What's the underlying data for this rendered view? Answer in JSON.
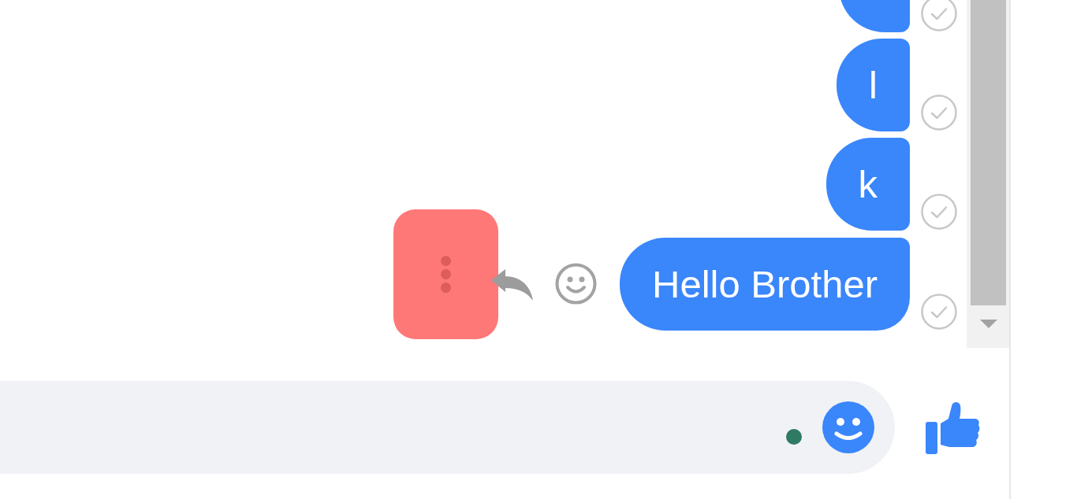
{
  "messages": [
    {
      "sent": true
    },
    {
      "text": "l",
      "sent": true
    },
    {
      "text": "k",
      "sent": true
    },
    {
      "text": "Hello Brother",
      "sent": true,
      "actions": [
        {
          "kind": "more",
          "highlighted": true
        },
        {
          "kind": "reply",
          "highlighted": false
        },
        {
          "kind": "react",
          "highlighted": false
        }
      ]
    }
  ],
  "composer": {
    "tools": [
      {
        "kind": "indicator"
      },
      {
        "kind": "emoji"
      }
    ],
    "send": {
      "kind": "like"
    }
  }
}
